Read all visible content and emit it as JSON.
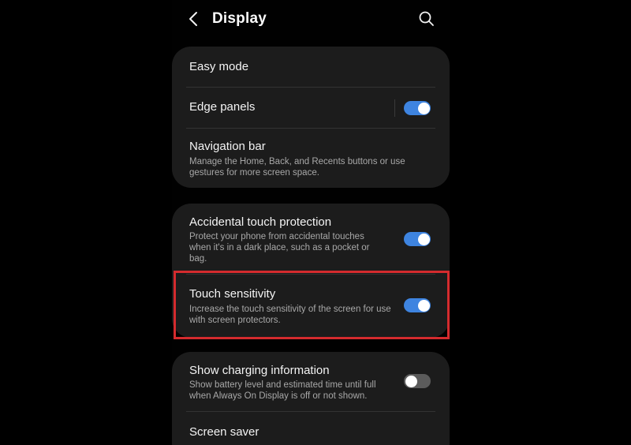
{
  "header": {
    "title": "Display",
    "back_icon": "chevron-left-icon",
    "search_icon": "search-icon"
  },
  "settings": {
    "easy_mode": {
      "label": "Easy mode"
    },
    "edge_panels": {
      "label": "Edge panels",
      "enabled": true
    },
    "navigation_bar": {
      "label": "Navigation bar",
      "description": "Manage the Home, Back, and Recents buttons or use gestures for more screen space."
    },
    "accidental_touch": {
      "label": "Accidental touch protection",
      "description": "Protect your phone from accidental touches when it's in a dark place, such as a pocket or bag.",
      "enabled": true
    },
    "touch_sensitivity": {
      "label": "Touch sensitivity",
      "description": "Increase the touch sensitivity of the screen for use with screen protectors.",
      "enabled": true
    },
    "charging_info": {
      "label": "Show charging information",
      "description": "Show battery level and estimated time until full when Always On Display is off or not shown.",
      "enabled": false
    },
    "screen_saver": {
      "label": "Screen saver"
    }
  },
  "colors": {
    "toggle_on": "#3e84e0",
    "toggle_off": "#5b5b5b",
    "card_bg": "#1c1c1c",
    "highlight": "#d42b2e"
  }
}
